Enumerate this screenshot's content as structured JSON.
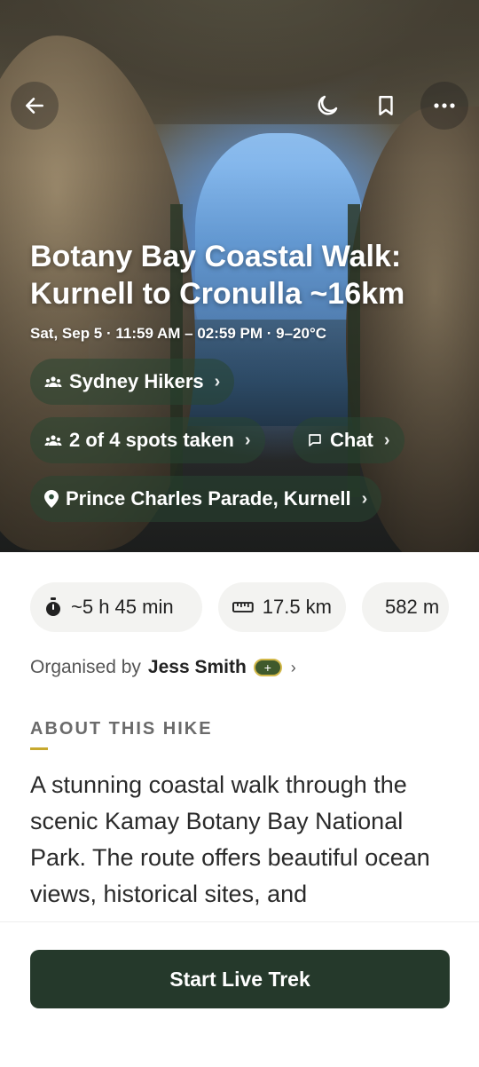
{
  "header": {
    "title": "Botany Bay Coastal Walk: Kurnell to Cronulla ~16km",
    "meta": "Sat, Sep 5 · 11:59 AM – 02:59 PM · 9–20°C"
  },
  "icons": {
    "back": "arrow-left-icon",
    "theme": "moon-icon",
    "bookmark": "bookmark-icon",
    "more": "more-dots-icon"
  },
  "pills": {
    "club": "Sydney Hikers",
    "spots": "2 of 4 spots taken",
    "chat": "Chat",
    "location": "Prince Charles Parade, Kurnell",
    "chevron": "›"
  },
  "stats": {
    "duration": "~5 h 45 min",
    "distance": "17.5 km",
    "elevation": "582 m"
  },
  "organiser": {
    "prefix": "Organised by",
    "name": "Jess Smith",
    "chevron": "›"
  },
  "about": {
    "heading": "ABOUT THIS HIKE",
    "text": "A stunning coastal walk through the scenic Kamay Botany Bay National Park. The route offers beautiful ocean views, historical sites, and"
  },
  "footer": {
    "start_label": "Start Live Trek"
  },
  "colors": {
    "accent_dark_green": "#25392b",
    "underline_gold": "#c7a92e"
  }
}
